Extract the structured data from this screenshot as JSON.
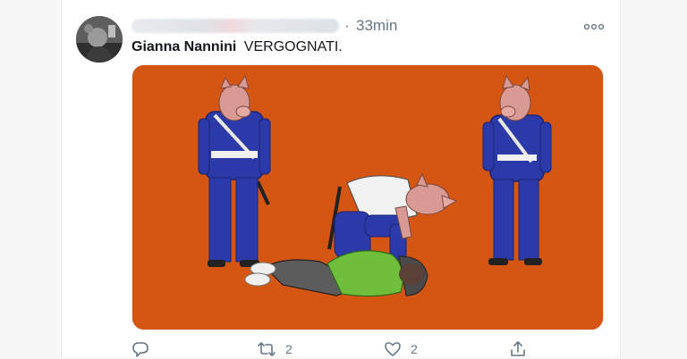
{
  "tweet": {
    "author_name": "Gianna Nannini",
    "text": "VERGOGNATI.",
    "separator": "·",
    "timestamp": "33min"
  },
  "actions": {
    "retweet_count": "2",
    "like_count": "2"
  },
  "icons": {
    "more": "more-horizontal-icon",
    "reply": "reply-icon",
    "retweet": "retweet-icon",
    "like": "heart-icon",
    "share": "share-icon"
  },
  "colors": {
    "media_background": "#d55512",
    "uniform": "#2b3aa8",
    "pig_skin": "#d99a94",
    "secondary_text": "#657786"
  }
}
